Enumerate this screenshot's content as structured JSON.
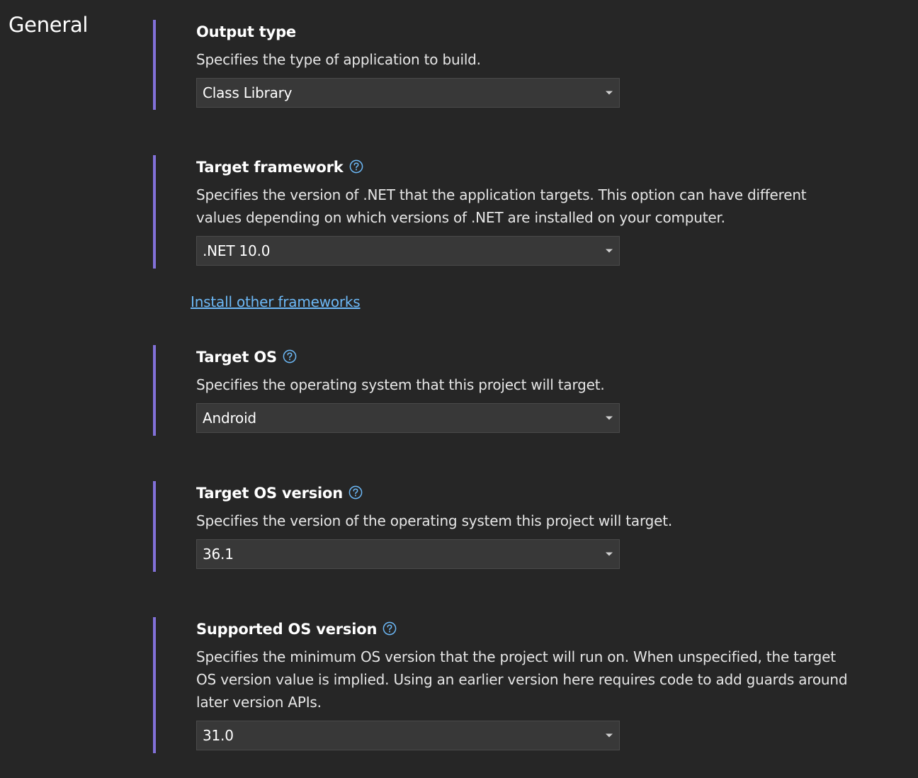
{
  "nav": {
    "title": "General"
  },
  "settings": {
    "output_type": {
      "title": "Output type",
      "description": "Specifies the type of application to build.",
      "value": "Class Library"
    },
    "target_framework": {
      "title": "Target framework",
      "description_line1": "Specifies the version of .NET that the application targets. This option can have different",
      "description_line2": "values depending on which versions of .NET are installed on your computer.",
      "value": ".NET 10.0"
    },
    "install_link": "Install other frameworks",
    "target_os": {
      "title": "Target OS",
      "description": "Specifies the operating system that this project will target.",
      "value": "Android"
    },
    "target_os_version": {
      "title": "Target OS version",
      "description": "Specifies the version of the operating system this project will target.",
      "value": "36.1"
    },
    "supported_os_version": {
      "title": "Supported OS version",
      "description_line1": "Specifies the minimum OS version that the project will run on. When unspecified, the target",
      "description_line2": "OS version value is implied. Using an earlier version here requires code to add guards around",
      "description_line3": "later version APIs.",
      "value": "31.0"
    }
  },
  "colors": {
    "background": "#262626",
    "accent_bar": "#8271d9",
    "link": "#6cb8f6",
    "dropdown_bg": "#383838",
    "help_icon": "#6cb8f6"
  },
  "icons": {
    "help": "question-circle-icon",
    "dropdown": "caret-down-icon"
  }
}
